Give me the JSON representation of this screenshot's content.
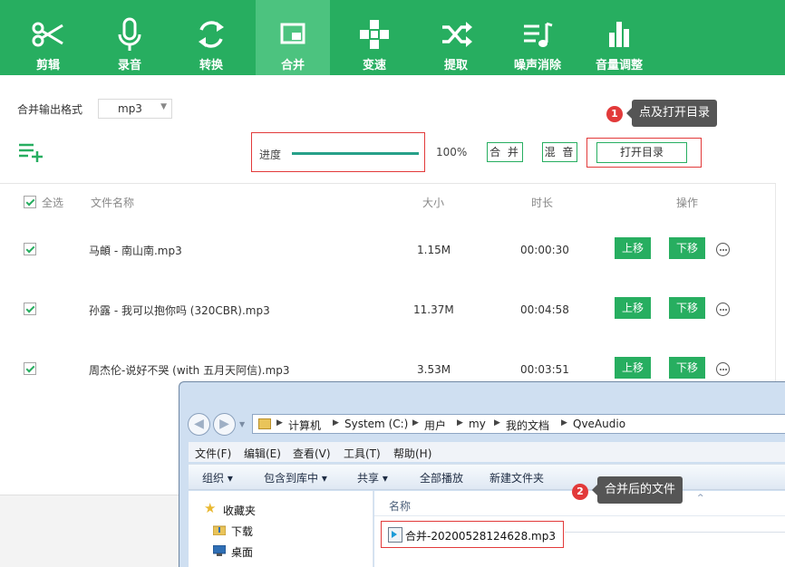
{
  "toolbar": {
    "tools": [
      {
        "label": "剪辑",
        "icon": "scissors-icon",
        "active": false
      },
      {
        "label": "录音",
        "icon": "microphone-icon",
        "active": false
      },
      {
        "label": "转换",
        "icon": "refresh-icon",
        "active": false
      },
      {
        "label": "合并",
        "icon": "merge-window-icon",
        "active": true
      },
      {
        "label": "变速",
        "icon": "speed-icon",
        "active": false
      },
      {
        "label": "提取",
        "icon": "shuffle-icon",
        "active": false
      },
      {
        "label": "噪声消除",
        "icon": "noise-list-icon",
        "active": false
      },
      {
        "label": "音量调整",
        "icon": "volume-bars-icon",
        "active": false
      }
    ]
  },
  "controls": {
    "format_label": "合并输出格式",
    "format_value": "mp3",
    "progress_label": "进度",
    "progress_percent": "100%",
    "progress_fraction": 1.0,
    "merge_button": "合 并",
    "mix_button": "混 音",
    "open_dir_button": "打开目录"
  },
  "tips": {
    "tip1_num": "1",
    "tip1_text": "点及打开目录",
    "tip2_num": "2",
    "tip2_text": "合并后的文件"
  },
  "table": {
    "select_all": "全选",
    "headers": {
      "name": "文件名称",
      "size": "大小",
      "duration": "时长",
      "actions": "操作"
    },
    "rows": [
      {
        "name": "马頔 - 南山南.mp3",
        "size": "1.15M",
        "duration": "00:00:30",
        "up": "上移",
        "down": "下移"
      },
      {
        "name": "孙露 - 我可以抱你吗 (320CBR).mp3",
        "size": "11.37M",
        "duration": "00:04:58",
        "up": "上移",
        "down": "下移"
      },
      {
        "name": "周杰伦-说好不哭 (with 五月天阿信).mp3",
        "size": "3.53M",
        "duration": "00:03:51",
        "up": "上移",
        "down": "下移"
      }
    ]
  },
  "explorer": {
    "path": [
      "计算机",
      "System (C:)",
      "用户",
      "my",
      "我的文档",
      "QveAudio"
    ],
    "menu": [
      "文件(F)",
      "编辑(E)",
      "查看(V)",
      "工具(T)",
      "帮助(H)"
    ],
    "commands": {
      "organize": "组织 ▾",
      "include": "包含到库中 ▾",
      "share": "共享 ▾",
      "play_all": "全部播放",
      "new_folder": "新建文件夹"
    },
    "nav": {
      "favorites": "收藏夹",
      "downloads": "下载",
      "desktop": "桌面"
    },
    "column_name": "名称",
    "file_name": "合并-20200528124628.mp3"
  }
}
